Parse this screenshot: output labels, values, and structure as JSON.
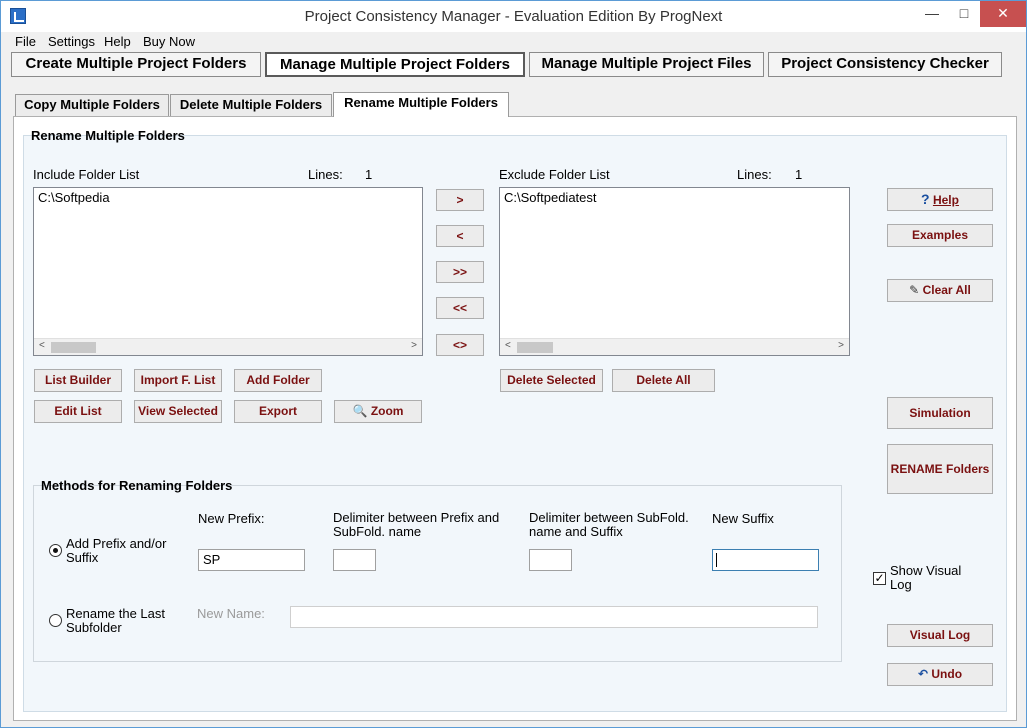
{
  "window": {
    "title": "Project Consistency Manager - Evaluation Edition  By ProgNext",
    "minimize": "—",
    "maximize": "□",
    "close": "✕"
  },
  "menu": [
    "File",
    "Settings",
    "Help",
    "Buy Now"
  ],
  "nav_tabs": [
    "Create Multiple Project Folders",
    "Manage Multiple Project Folders",
    "Manage Multiple Project Files",
    "Project Consistency Checker"
  ],
  "sub_tabs": [
    "Copy Multiple Folders",
    "Delete Multiple Folders",
    "Rename Multiple Folders"
  ],
  "panel_title": "Rename Multiple Folders",
  "include": {
    "label": "Include Folder List",
    "lines_label": "Lines:",
    "lines_count": "1",
    "items": [
      "C:\\Softpedia"
    ]
  },
  "exclude": {
    "label": "Exclude Folder List",
    "lines_label": "Lines:",
    "lines_count": "1",
    "items": [
      "C:\\Softpediatest"
    ]
  },
  "transfer_buttons": [
    ">",
    "<",
    ">>",
    "<<",
    "<>"
  ],
  "include_buttons": {
    "list_builder": "List Builder",
    "import": "Import F. List",
    "add_folder": "Add Folder",
    "edit_list": "Edit List",
    "view_selected": "View Selected",
    "export": "Export",
    "zoom": "Zoom"
  },
  "exclude_buttons": {
    "delete_selected": "Delete Selected",
    "delete_all": "Delete All"
  },
  "side_buttons": {
    "help": "Help",
    "examples": "Examples",
    "clear_all": "Clear All",
    "simulation": "Simulation",
    "rename": "RENAME Folders",
    "visual_log": "Visual Log",
    "undo": "Undo"
  },
  "show_visual_log": {
    "label": "Show Visual Log",
    "checked": true
  },
  "methods": {
    "title": "Methods for Renaming Folders",
    "option1": "Add Prefix and/or Suffix",
    "option2": "Rename the Last Subfolder",
    "new_prefix_label": "New Prefix:",
    "new_prefix_value": "SP",
    "delim1_label": "Delimiter between Prefix and SubFold. name",
    "delim1_value": "",
    "delim2_label": "Delimiter between SubFold. name and Suffix",
    "delim2_value": "",
    "new_suffix_label": "New Suffix",
    "new_suffix_value": "",
    "new_name_label": "New Name:",
    "new_name_value": ""
  }
}
